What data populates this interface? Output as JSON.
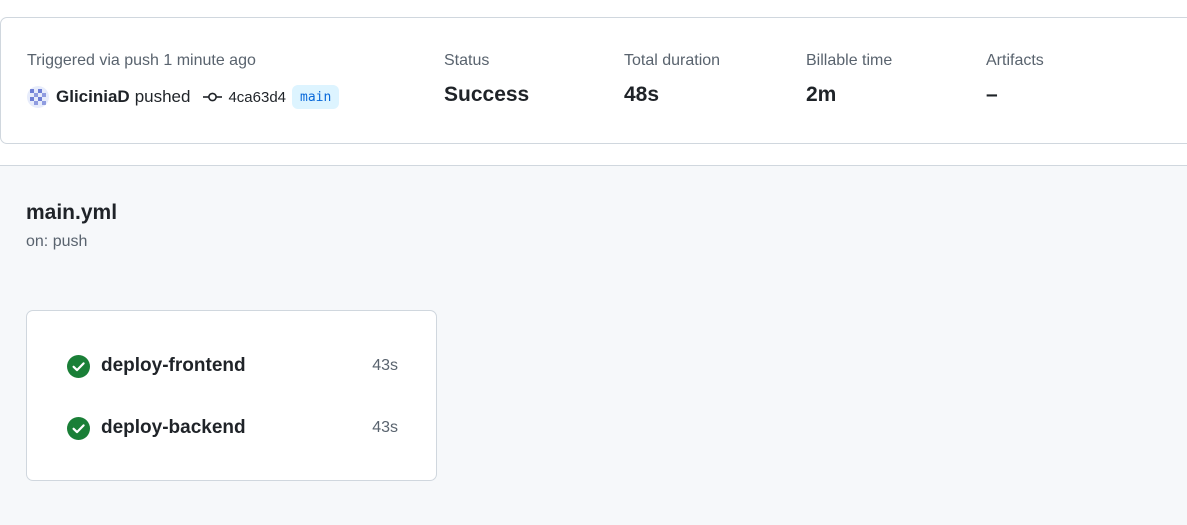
{
  "run_summary": {
    "trigger_label": "Triggered via push 1 minute ago",
    "actor": "GliciniaD",
    "action": "pushed",
    "commit_sha": "4ca63d4",
    "branch": "main",
    "status_label": "Status",
    "status_value": "Success",
    "duration_label": "Total duration",
    "duration_value": "48s",
    "billable_label": "Billable time",
    "billable_value": "2m",
    "artifacts_label": "Artifacts",
    "artifacts_value": "–"
  },
  "workflow": {
    "file_name": "main.yml",
    "trigger": "on: push",
    "jobs": [
      {
        "name": "deploy-frontend",
        "duration": "43s",
        "status": "success",
        "icon": "check-circle-icon"
      },
      {
        "name": "deploy-backend",
        "duration": "43s",
        "status": "success",
        "icon": "check-circle-icon"
      }
    ]
  },
  "colors": {
    "success": "#1a7f37",
    "branch_badge_bg": "#ddf4ff",
    "branch_badge_text": "#0969da",
    "muted_text": "#59636e",
    "workflow_bg": "#f6f8fa"
  }
}
